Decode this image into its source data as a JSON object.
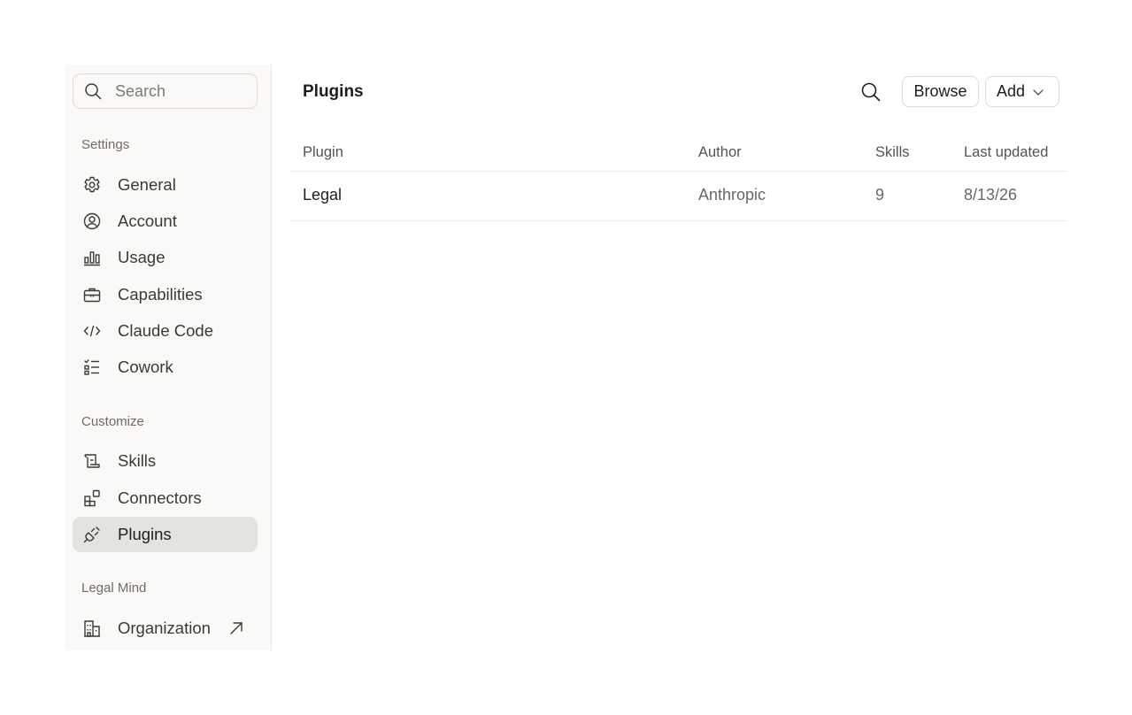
{
  "sidebar": {
    "search_placeholder": "Search",
    "sections": {
      "settings": "Settings",
      "customize": "Customize",
      "org": "Legal Mind"
    },
    "items": {
      "general": "General",
      "account": "Account",
      "usage": "Usage",
      "capabilities": "Capabilities",
      "claude_code": "Claude Code",
      "cowork": "Cowork",
      "skills": "Skills",
      "connectors": "Connectors",
      "plugins": "Plugins",
      "organization": "Organization"
    },
    "active_item": "plugins"
  },
  "main": {
    "title": "Plugins",
    "buttons": {
      "browse": "Browse",
      "add": "Add"
    },
    "table": {
      "headers": [
        "Plugin",
        "Author",
        "Skills",
        "Last updated"
      ],
      "rows": [
        [
          "Legal",
          "Anthropic",
          "9",
          "8/13/26"
        ]
      ]
    }
  },
  "colors": {
    "sidebar_bg": "#faf9f7",
    "active_bg": "#e5e3de",
    "text": "#1f1e1d",
    "muted_text": "#6f6d66",
    "border": "#dedbd3"
  }
}
